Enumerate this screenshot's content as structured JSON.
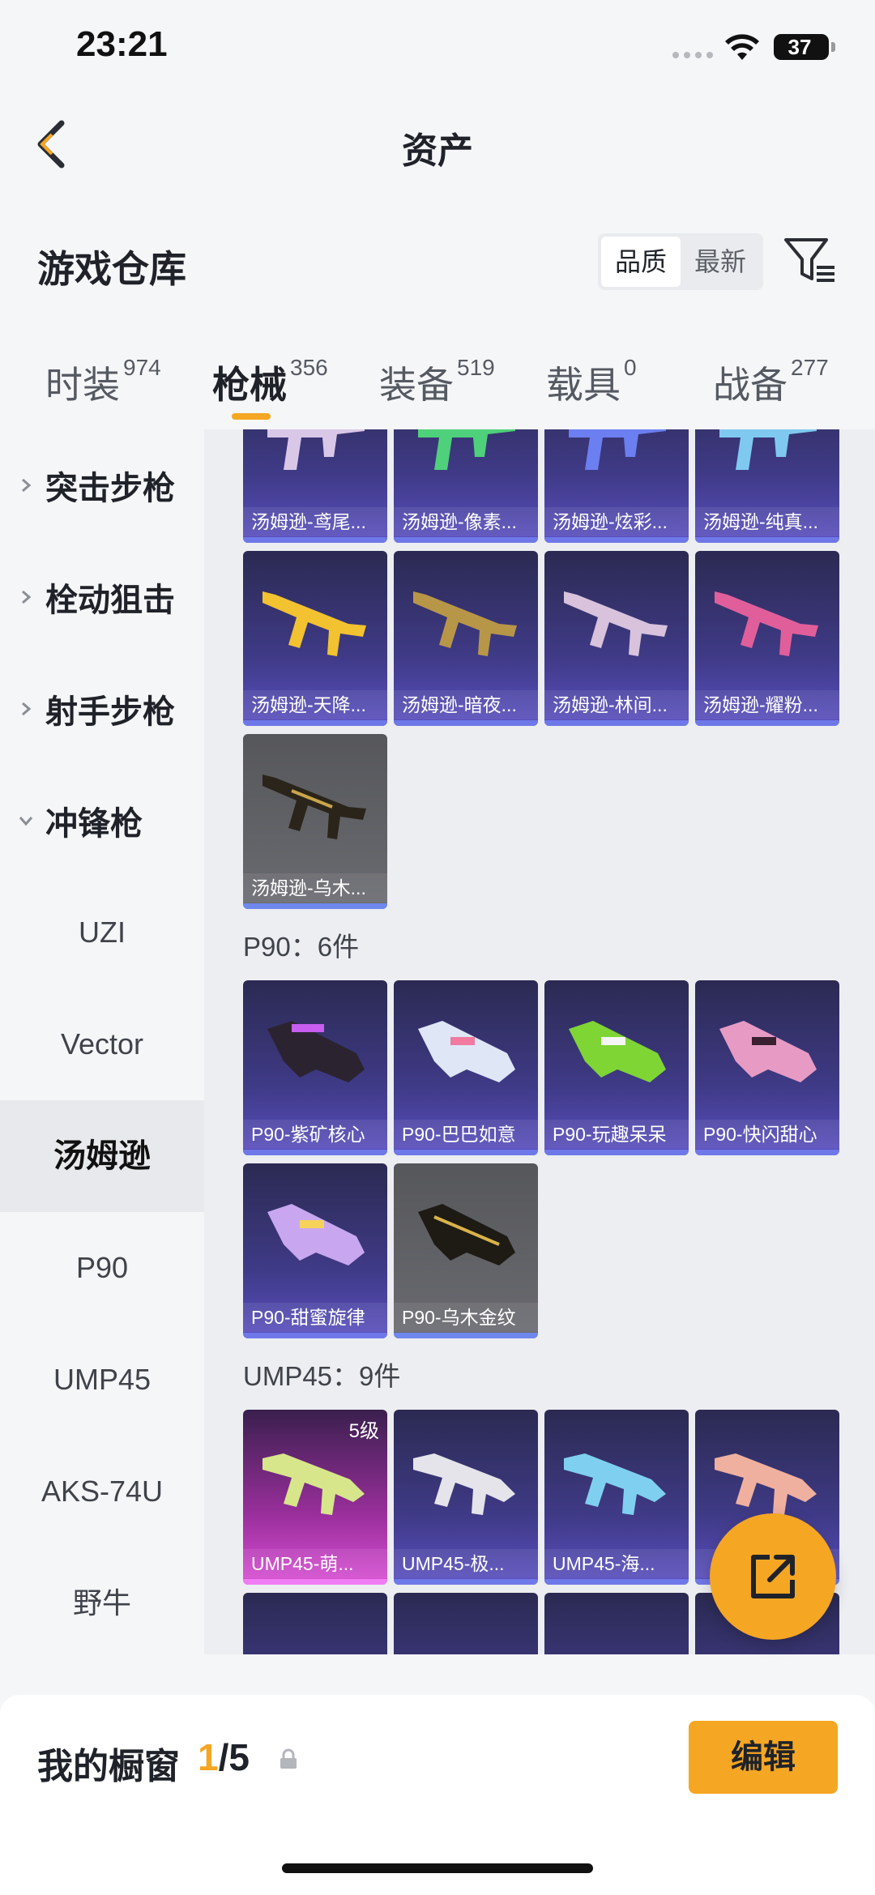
{
  "status": {
    "time": "23:21",
    "battery": "37"
  },
  "header": {
    "title": "资产"
  },
  "section": {
    "title": "游戏仓库"
  },
  "sort": {
    "options": [
      "品质",
      "最新"
    ],
    "active": "品质"
  },
  "tabs": [
    {
      "label": "时装",
      "count": "974"
    },
    {
      "label": "枪械",
      "count": "356"
    },
    {
      "label": "装备",
      "count": "519"
    },
    {
      "label": "载具",
      "count": "0"
    },
    {
      "label": "战备",
      "count": "277"
    }
  ],
  "sidebar": {
    "categories": [
      "突击步枪",
      "栓动狙击",
      "射手步枪",
      "冲锋枪"
    ],
    "subs": [
      "UZI",
      "Vector",
      "汤姆逊",
      "P90",
      "UMP45",
      "AKS-74U",
      "野牛"
    ],
    "active_sub": "汤姆逊"
  },
  "content": {
    "row0": [
      "汤姆逊-鸢尾...",
      "汤姆逊-像素...",
      "汤姆逊-炫彩...",
      "汤姆逊-纯真..."
    ],
    "row1": [
      "汤姆逊-天降...",
      "汤姆逊-暗夜...",
      "汤姆逊-林间...",
      "汤姆逊-耀粉..."
    ],
    "row2": [
      "汤姆逊-乌木..."
    ],
    "p90_title": "P90：6件",
    "p90_row0": [
      "P90-紫矿核心",
      "P90-巴巴如意",
      "P90-玩趣呆呆",
      "P90-快闪甜心"
    ],
    "p90_row1": [
      "P90-甜蜜旋律",
      "P90-乌木金纹"
    ],
    "ump_title": "UMP45：9件",
    "ump_row0": [
      "UMP45-萌...",
      "UMP45-极...",
      "UMP45-海...",
      ""
    ],
    "ump_level": "5级"
  },
  "showcase": {
    "title": "我的橱窗",
    "current": "1",
    "total": "/5",
    "edit_label": "编辑"
  },
  "colors": {
    "accent": "#f5a623",
    "card_purple": "#3f3a86",
    "card_gray": "#5f6064",
    "card_pink": "#9a2f9c"
  }
}
